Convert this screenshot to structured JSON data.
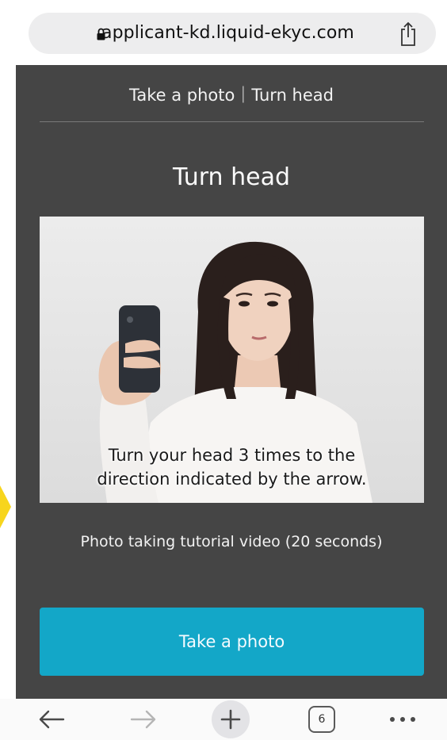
{
  "browser": {
    "url": "applicant-kd.liquid-ekyc.com",
    "tab_count": "6"
  },
  "app": {
    "header": "Take a photo｜Turn head",
    "step_title": "Turn head",
    "video_overlay_line1": "Turn your head 3 times to the",
    "video_overlay_line2": "direction indicated by the arrow.",
    "video_caption": "Photo taking tutorial video (20 seconds)",
    "take_photo_label": "Take a photo"
  },
  "colors": {
    "app_background": "#454545",
    "button": "#13a7c8",
    "side_arrow": "#f7d51d"
  }
}
